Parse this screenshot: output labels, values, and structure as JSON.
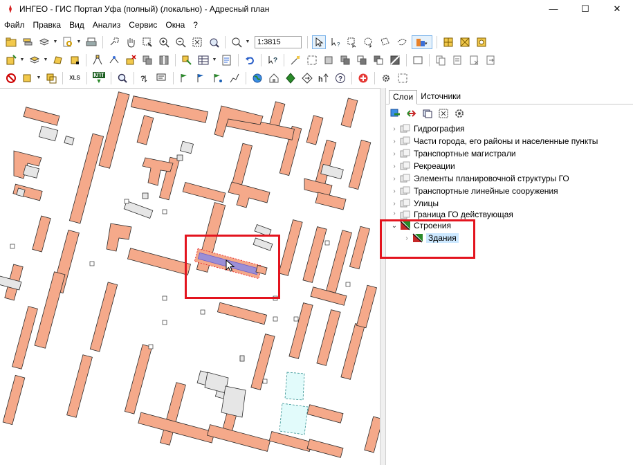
{
  "window": {
    "title": "ИНГЕО - ГИС Портал Уфа (полный) (локально) - Адресный план",
    "minimize": "—",
    "maximize": "☐",
    "close": "✕"
  },
  "menu": [
    "Файл",
    "Правка",
    "Вид",
    "Анализ",
    "Сервис",
    "Окна",
    "?"
  ],
  "toolbar": {
    "scale": "1:3815",
    "xls_label": "XLS",
    "kpt_label": "КПТ"
  },
  "panel": {
    "tabs": [
      "Слои",
      "Источники"
    ],
    "layers": [
      {
        "label": "Гидрография"
      },
      {
        "label": "Части города, его районы и населенные пункты"
      },
      {
        "label": "Транспортные магистрали"
      },
      {
        "label": "Рекреации"
      },
      {
        "label": "Элементы планировочной структуры ГО"
      },
      {
        "label": "Транспортные линейные сооружения"
      },
      {
        "label": "Улицы"
      },
      {
        "label": "Граница ГО действующая"
      }
    ],
    "expanded_layer": {
      "label": "Строения",
      "child": "Здания"
    }
  },
  "colors": {
    "building_fill": "#f5a98a",
    "building_stroke": "#2a2a2a",
    "highlight": "#e3141e",
    "selected_building": "#9b8fd6",
    "gray_building": "#e6e6e6",
    "cyan_building": "#e2fbfb"
  }
}
